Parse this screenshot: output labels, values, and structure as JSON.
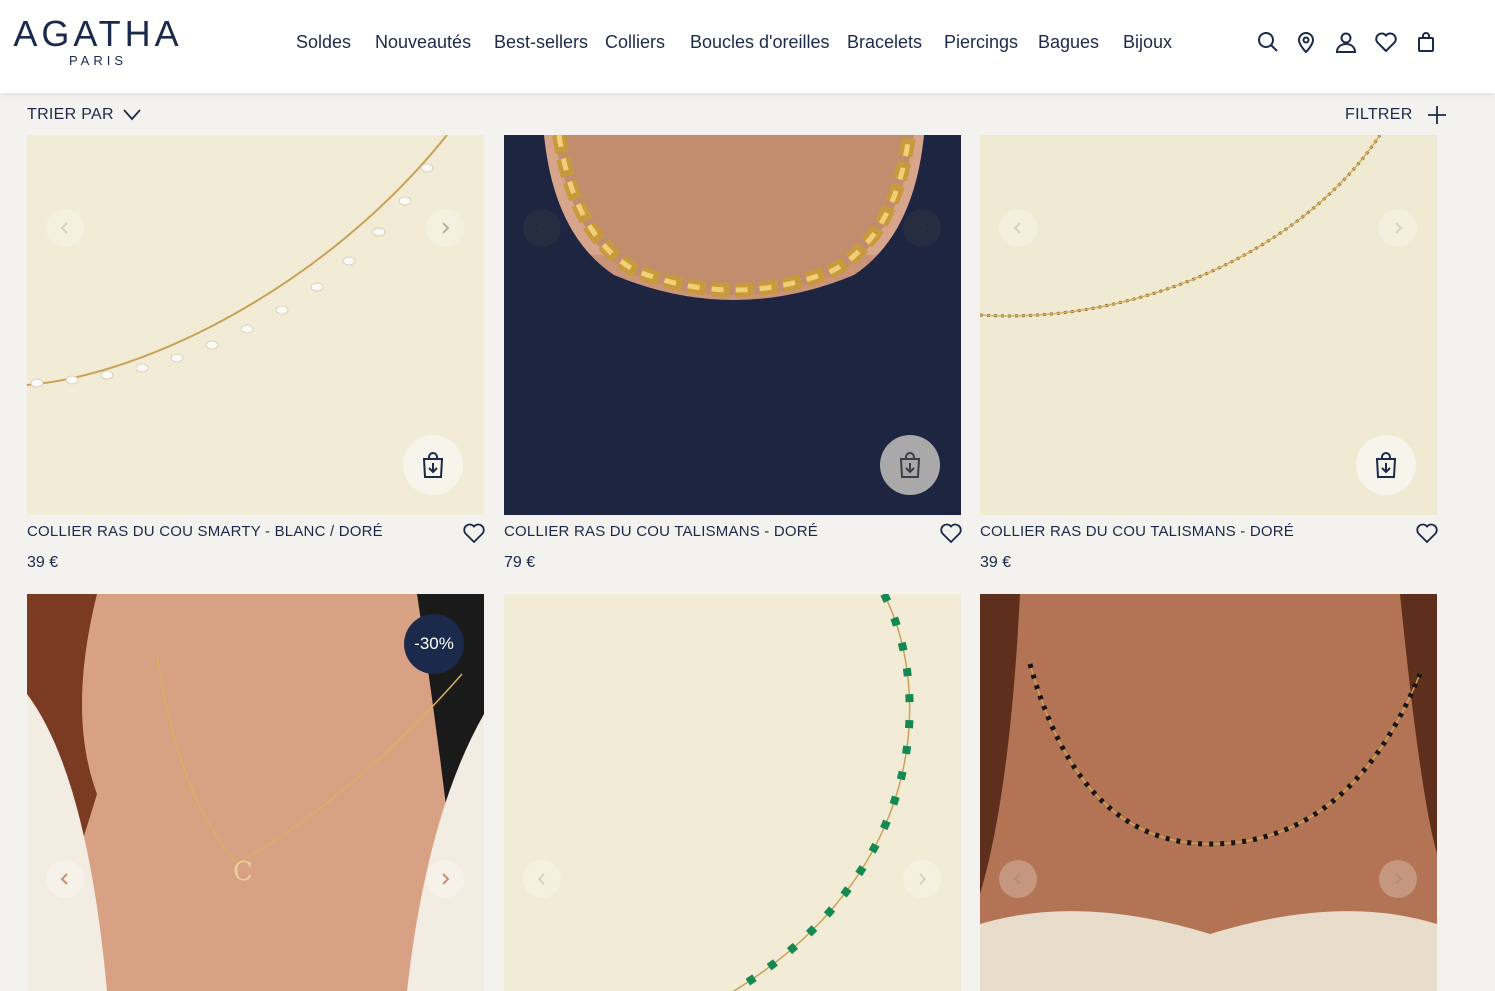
{
  "brand": {
    "name": "AGATHA",
    "sub": "PARIS"
  },
  "nav": [
    "Soldes",
    "Nouveautés",
    "Best-sellers",
    "Colliers",
    "Boucles d'oreilles",
    "Bracelets",
    "Piercings",
    "Bagues",
    "Bijoux"
  ],
  "header_icons": [
    "search-icon",
    "store-locator-icon",
    "account-icon",
    "wishlist-icon",
    "cart-icon"
  ],
  "toolbar": {
    "sort_label": "TRIER PAR",
    "filter_label": "FILTRER"
  },
  "colors": {
    "brand_navy": "#1b2a4a",
    "page_bg": "#f4f2ee"
  },
  "products": [
    {
      "title": "COLLIER RAS DU COU SMARTY - BLANC / DORÉ",
      "price": "39 €"
    },
    {
      "title": "COLLIER RAS DU COU TALISMANS - DORÉ",
      "price": "79 €"
    },
    {
      "title": "COLLIER RAS DU COU TALISMANS - DORÉ",
      "price": "39 €"
    },
    {
      "title": "",
      "price": "",
      "badge": "-30%"
    },
    {
      "title": "",
      "price": ""
    },
    {
      "title": "",
      "price": ""
    }
  ]
}
